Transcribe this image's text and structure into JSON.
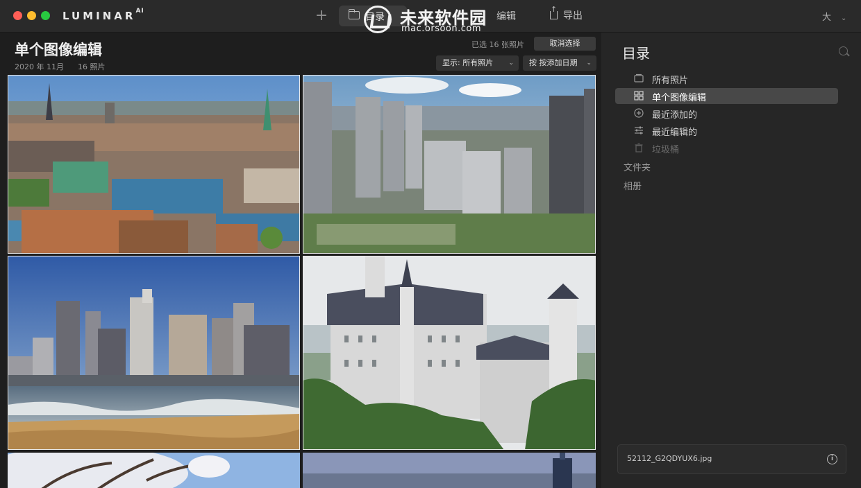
{
  "app": {
    "name": "LUMINAR",
    "name_sup": "AI"
  },
  "toolbar": {
    "add_label": "+",
    "tab_catalog": "目录",
    "tab_edit": "编辑",
    "tab_export": "导出",
    "size_label": "大"
  },
  "watermark": {
    "title": "未来软件园",
    "url": "mac.orsoon.com"
  },
  "main": {
    "title": "单个图像编辑",
    "date": "2020 年 11月",
    "count": "16 照片",
    "selected": "已选 16 张照片",
    "deselect": "取消选择",
    "filter": "显示:  所有照片",
    "sort": "按 按添加日期"
  },
  "sidebar": {
    "title": "目录",
    "items": [
      {
        "label": "所有照片",
        "icon": "photos-icon"
      },
      {
        "label": "单个图像编辑",
        "icon": "grid-icon",
        "active": true
      },
      {
        "label": "最近添加的",
        "icon": "plus-circle-icon"
      },
      {
        "label": "最近编辑的",
        "icon": "sliders-icon"
      },
      {
        "label": "垃圾桶",
        "icon": "trash-icon",
        "disabled": true
      }
    ],
    "folders_label": "文件夹",
    "albums_label": "相册",
    "file_name": "52112_G2QDYUX6.jpg"
  },
  "photos": [
    {
      "subject": "city-aerial"
    },
    {
      "subject": "skyscrapers"
    },
    {
      "subject": "beach-skyline"
    },
    {
      "subject": "castle"
    },
    {
      "subject": "cherry-blossom"
    },
    {
      "subject": "tower-dusk"
    }
  ]
}
